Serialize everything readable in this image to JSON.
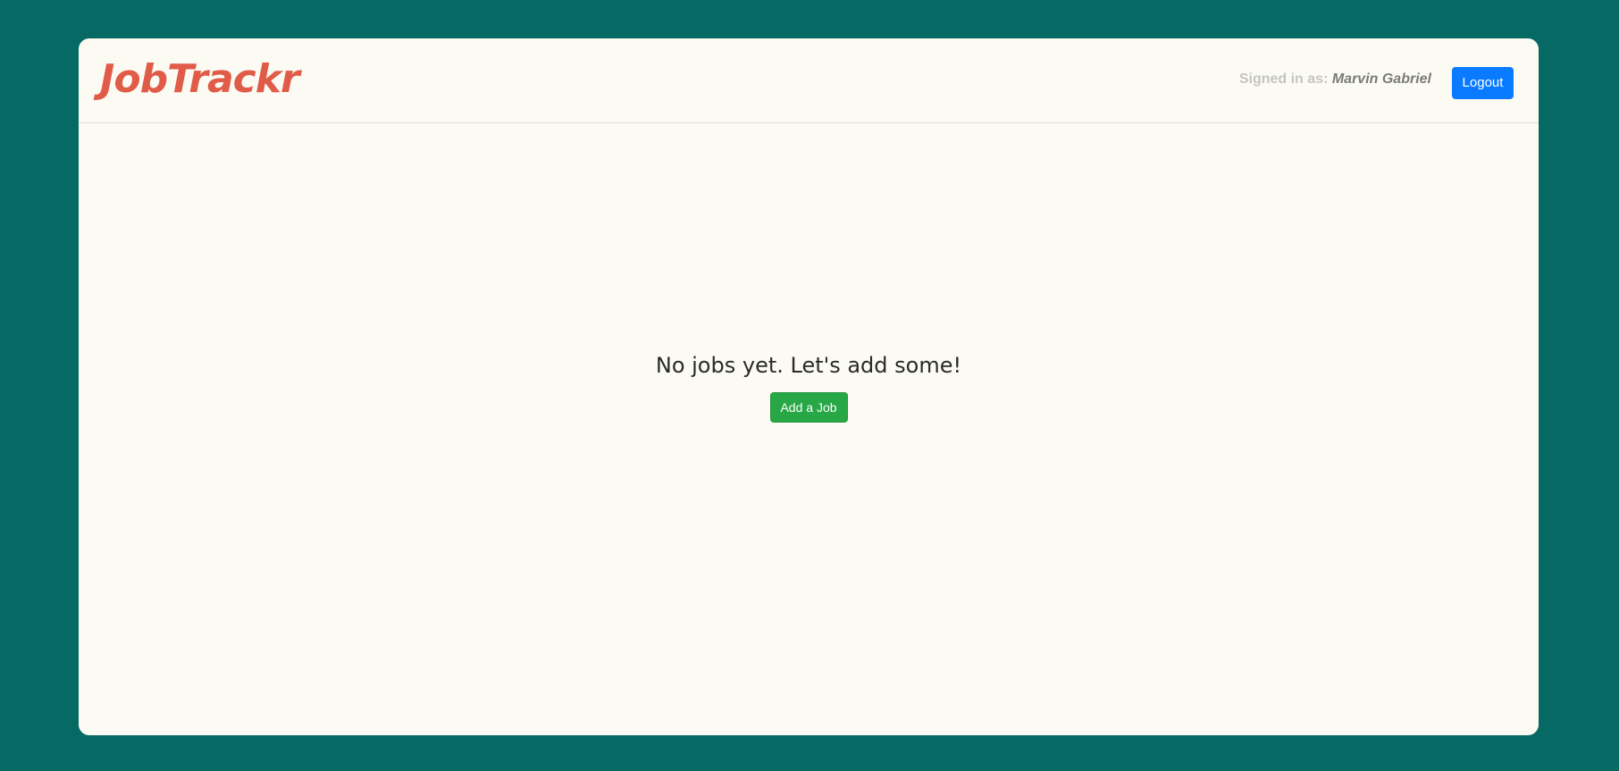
{
  "app": {
    "title": "JobTrackr"
  },
  "header": {
    "signed_in_label": "Signed in as:",
    "user_name": "Marvin Gabriel",
    "logout_label": "Logout"
  },
  "main": {
    "empty_message": "No jobs yet. Let's add some!",
    "add_job_label": "Add a Job"
  },
  "colors": {
    "background": "#066964",
    "card": "#fcfbf3",
    "brand": "#e15b49",
    "primary_button": "#0a7bff",
    "success_button": "#28a746"
  }
}
